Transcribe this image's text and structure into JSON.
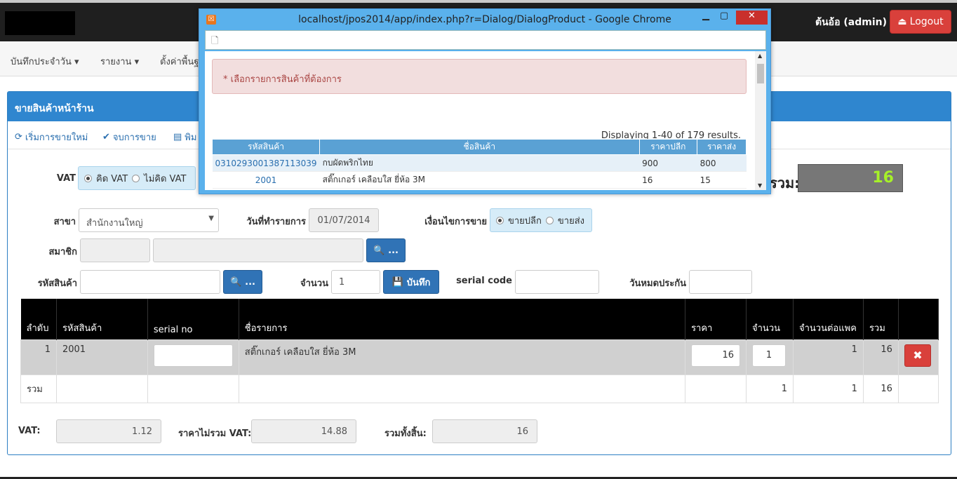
{
  "header": {
    "user": "ต้นอ้อ (admin)",
    "logout": "Logout"
  },
  "nav": [
    {
      "label": "บันทึกประจำวัน"
    },
    {
      "label": "รายงาน"
    },
    {
      "label": "ตั้งค่าพื้นฐ"
    }
  ],
  "panel": {
    "title": "ขายสินค้าหน้าร้าน",
    "tools": [
      "เริ่มการขายใหม่",
      "จบการขาย",
      "พิม"
    ]
  },
  "form": {
    "vat_label": "VAT",
    "vat_opt1": "คิด VAT",
    "vat_opt2": "ไม่คิด VAT",
    "total_label": "รวม:",
    "total_value": "16",
    "branch_label": "สาขา",
    "branch_value": "สำนักงานใหญ่",
    "date_label": "วันที่ทำรายการ",
    "date_value": "01/07/2014",
    "cond_label": "เงื่อนไขการขาย",
    "cond_opt1": "ขายปลีก",
    "cond_opt2": "ขายส่ง",
    "member_label": "สมาชิก",
    "search_btn": "...",
    "product_code_label": "รหัสสินค้า",
    "qty_label": "จำนวน",
    "qty_value": "1",
    "save_btn": "บันทึก",
    "serial_label": "serial code",
    "warranty_label": "วันหมดประกัน"
  },
  "table": {
    "headers": [
      "ลำดับ",
      "รหัสสินค้า",
      "serial no",
      "ชื่อรายการ",
      "ราคา",
      "จำนวน",
      "จำนวนต่อแพค",
      "รวม",
      ""
    ],
    "row": {
      "no": "1",
      "code": "2001",
      "name": "สติ๊กเกอร์ เคลือบใส ยี่ห้อ 3M",
      "price": "16",
      "qty": "1",
      "pack": "1",
      "sum": "16"
    },
    "total_row": {
      "label": "รวม",
      "qty": "1",
      "pack": "1",
      "sum": "16"
    }
  },
  "summary": {
    "vat_label": "VAT:",
    "vat_value": "1.12",
    "novat_label": "ราคาไม่รวม VAT:",
    "novat_value": "14.88",
    "grand_label": "รวมทั้งสิ้น:",
    "grand_value": "16"
  },
  "popup": {
    "title": "localhost/jpos2014/app/index.php?r=Dialog/DialogProduct - Google Chrome",
    "alert": "* เลือกรายการสินค้าที่ต้องการ",
    "results": "Displaying 1-40 of 179 results.",
    "headers": [
      "รหัสสินค้า",
      "ชื่อสินค้า",
      "ราคาปลีก",
      "ราคาส่ง"
    ],
    "rows": [
      {
        "code": "0310293001387113039",
        "name": "กบผัดพริกไทย",
        "retail": "900",
        "wholesale": "800"
      },
      {
        "code": "2001",
        "name": "สติ๊กเกอร์ เคลือบใส ยี่ห้อ 3M",
        "retail": "16",
        "wholesale": "15"
      }
    ]
  }
}
